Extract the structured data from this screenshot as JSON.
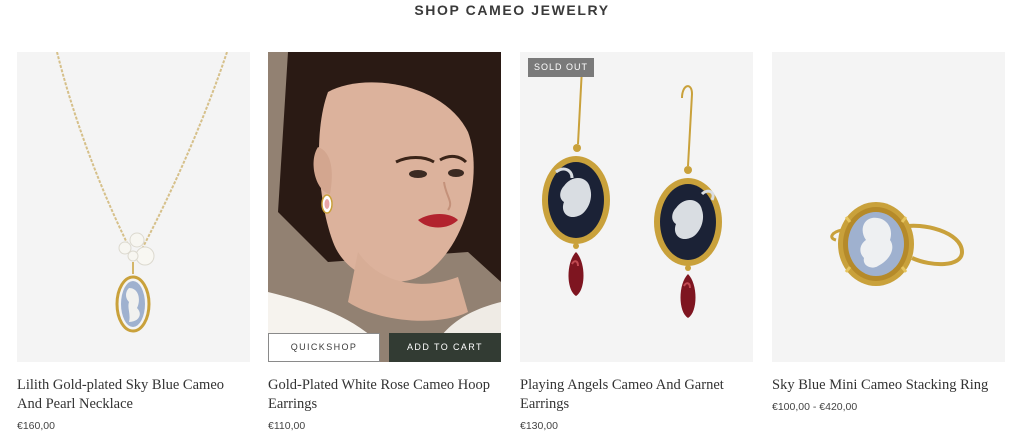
{
  "section": {
    "title": "SHOP CAMEO JEWELRY"
  },
  "products": [
    {
      "name": "Lilith Gold-plated Sky Blue Cameo And Pearl Necklace",
      "price": "€160,00",
      "image": "cameo-necklace"
    },
    {
      "name": "Gold-Plated White Rose Cameo Hoop Earrings",
      "price": "€110,00",
      "image": "model-wearing-earrings",
      "actions": {
        "quickshop": "QUICKSHOP",
        "add_to_cart": "ADD TO CART"
      }
    },
    {
      "name": "Playing Angels Cameo And Garnet Earrings",
      "price": "€130,00",
      "badge": "SOLD OUT",
      "image": "angel-cameo-earrings"
    },
    {
      "name": "Sky Blue Mini Cameo Stacking Ring",
      "price": "€100,00 - €420,00",
      "image": "cameo-ring"
    }
  ],
  "colors": {
    "card_background": "#f4f4f4",
    "badge_background": "#7a7a7a",
    "add_to_cart_background": "#323b33",
    "gold": "#c9a13b",
    "cameo_blue": "#9fb1cf",
    "garnet": "#7e1520"
  }
}
